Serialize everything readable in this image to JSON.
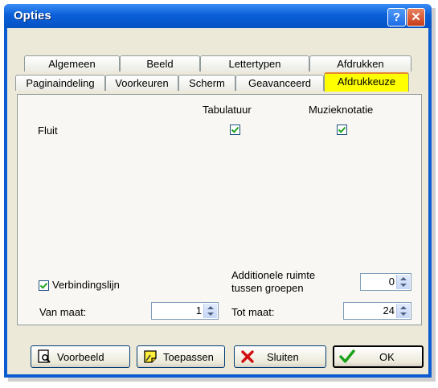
{
  "window": {
    "title": "Opties",
    "help_glyph": "?",
    "close_glyph": "✕"
  },
  "tabs_row1": [
    "Algemeen",
    "Beeld",
    "Lettertypen",
    "Afdrukken"
  ],
  "tabs_row2": [
    "Paginaindeling",
    "Voorkeuren",
    "Scherm",
    "Geavanceerd",
    "Afdrukkeuze"
  ],
  "active_tab": "Afdrukkeuze",
  "columns": {
    "tab": "Tabulatuur",
    "notation": "Muzieknotatie"
  },
  "rows": [
    {
      "label": "Fluit",
      "tabulatuur": true,
      "muzieknotatie": true
    }
  ],
  "options": {
    "verbindingslijn_label": "Verbindingslijn",
    "verbindingslijn_checked": true,
    "extra_space_label_1": "Additionele ruimte",
    "extra_space_label_2": "tussen groepen",
    "extra_space_value": "0",
    "from_label": "Van maat:",
    "from_value": "1",
    "to_label": "Tot maat:",
    "to_value": "24"
  },
  "buttons": {
    "preview": "Voorbeeld",
    "apply": "Toepassen",
    "close": "Sluiten",
    "ok": "OK"
  },
  "colors": {
    "title_bar": "#0b5fd8",
    "active_tab": "#ffff00",
    "dialog_bg": "#ece9d8",
    "check_green": "#21a121"
  },
  "icons": [
    "help-icon",
    "close-icon",
    "check-icon",
    "spin-up-icon",
    "spin-down-icon",
    "preview-icon",
    "apply-icon",
    "x-icon",
    "ok-check-icon"
  ]
}
